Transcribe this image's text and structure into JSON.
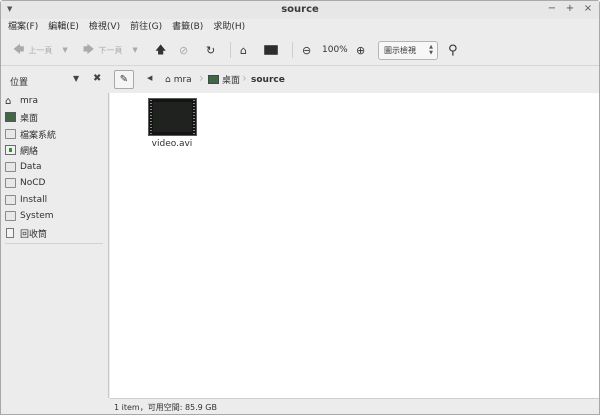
{
  "window": {
    "title": "source",
    "controls": [
      "−",
      "+",
      "×"
    ]
  },
  "menubar": [
    "檔案(F)",
    "編輯(E)",
    "檢視(V)",
    "前往(G)",
    "書籤(B)",
    "求助(H)"
  ],
  "toolbar": {
    "back_label": "上一頁",
    "forward_label": "下一頁",
    "zoom": "100%",
    "view_mode": "圖示檢視"
  },
  "sidebar": {
    "header": "位置",
    "items": [
      {
        "label": "mra",
        "icon": "home-icon"
      },
      {
        "label": "桌面",
        "icon": "desktop-icon"
      },
      {
        "label": "檔案系統",
        "icon": "drive-icon"
      },
      {
        "label": "網絡",
        "icon": "network-icon"
      },
      {
        "label": "Data",
        "icon": "drive-icon"
      },
      {
        "label": "NoCD",
        "icon": "drive-icon"
      },
      {
        "label": "Install",
        "icon": "drive-icon"
      },
      {
        "label": "System",
        "icon": "drive-icon"
      },
      {
        "label": "回收筒",
        "icon": "trash-icon"
      }
    ]
  },
  "breadcrumb": [
    "mra",
    "桌面",
    "source"
  ],
  "files": [
    {
      "name": "video.avi",
      "icon": "video-file-icon"
    }
  ],
  "status": "1 item，可用空間: 85.9 GB"
}
